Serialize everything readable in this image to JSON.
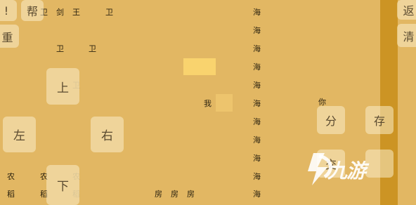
{
  "map": {
    "row_top": [
      "卫",
      "剑",
      "王",
      "卫"
    ],
    "row_second": [
      "卫",
      "卫"
    ],
    "guard_behind_up": "卫",
    "player": "我",
    "npc": "你",
    "farm_top": [
      "农",
      "农",
      "农"
    ],
    "farm_bottom": [
      "稻",
      "稻",
      "稻"
    ],
    "houses": [
      "房",
      "房",
      "房"
    ],
    "sea": [
      "海",
      "海",
      "海",
      "海",
      "海",
      "海",
      "海",
      "海",
      "海",
      "海",
      "海"
    ],
    "partial_char": "交"
  },
  "controls": {
    "exclaim": "!",
    "help": "帮",
    "restart": "重",
    "up": "上",
    "left": "左",
    "right": "右",
    "down": "下",
    "back": "返",
    "clear": "清",
    "share": "分",
    "save": "存"
  },
  "colors": {
    "background": "#E2B763",
    "highlight_tile": "#F9D36E",
    "side_bar": "#CC9424"
  }
}
